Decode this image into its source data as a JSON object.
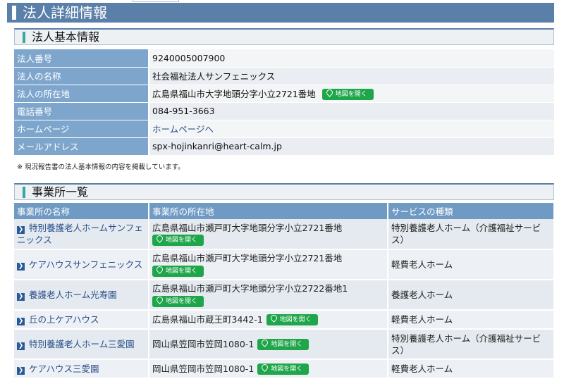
{
  "page": {
    "title": "法人詳細情報"
  },
  "basic": {
    "section_title": "法人基本情報",
    "rows": [
      {
        "label": "法人番号",
        "value": "9240005007900"
      },
      {
        "label": "法人の名称",
        "value": "社会福祉法人サンフェニックス"
      },
      {
        "label": "法人の所在地",
        "value": "広島県福山市大字地頭分字小立2721番地",
        "map_button": "地図を開く"
      },
      {
        "label": "電話番号",
        "value": "084-951-3663"
      },
      {
        "label": "ホームページ",
        "value": "ホームページへ"
      },
      {
        "label": "メールアドレス",
        "value": "spx-hojinkanri@heart-calm.jp"
      }
    ],
    "note": "※ 現況報告書の法人基本情報の内容を掲載しています。"
  },
  "offices": {
    "section_title": "事業所一覧",
    "headers": [
      "事業所の名称",
      "事業所の所在地",
      "サービスの種類"
    ],
    "map_button": "地図を開く",
    "rows": [
      {
        "name": "特別養護老人ホームサンフェニックス",
        "address": "広島県福山市瀬戸町大字地頭分字小立2721番地",
        "service": "特別養護老人ホーム（介護福祉サービス）"
      },
      {
        "name": "ケアハウスサンフェニックス",
        "address": "広島県福山市瀬戸町大字地頭分字小立2721番地",
        "service": "軽費老人ホーム"
      },
      {
        "name": "養護老人ホーム光寿園",
        "address": "広島県福山市瀬戸町大字地頭分字小立2722番地1",
        "service": "養護老人ホーム"
      },
      {
        "name": "丘の上ケアハウス",
        "address": "広島県福山市蔵王町3442-1",
        "service": "軽費老人ホーム"
      },
      {
        "name": "特別養護老人ホーム三愛園",
        "address": "岡山県笠岡市笠岡1080-1",
        "service": "特別養護老人ホーム（介護福祉サービス）"
      },
      {
        "name": "ケアハウス三愛園",
        "address": "岡山県笠岡市笠岡1080-1",
        "service": "軽費老人ホーム"
      }
    ]
  },
  "colors": {
    "title_bar": "#5a7fa8",
    "label_bg": "#7ea6cc",
    "map_button": "#1fa64a",
    "link": "#2a4f8a"
  }
}
